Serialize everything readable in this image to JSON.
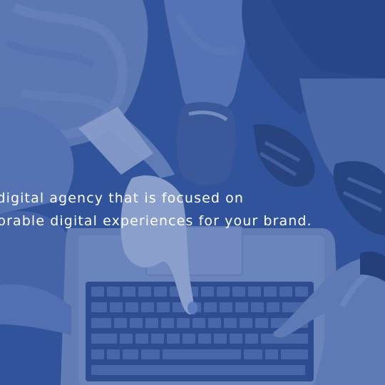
{
  "hero": {
    "tagline_line1": "ce digital agency that is focused on",
    "tagline_line2": "emorable digital experiences for your brand.",
    "overlay_color": "#2d52a0",
    "text_color": "#ffffff"
  },
  "background_photo": {
    "icon": "team-hands-laptop-photo"
  }
}
